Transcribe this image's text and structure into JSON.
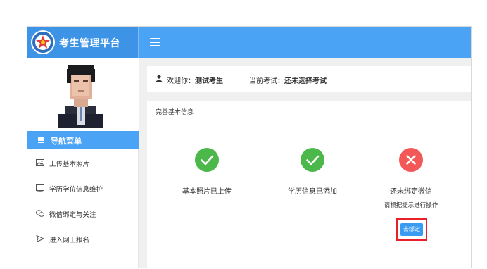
{
  "app": {
    "title": "考生管理平台"
  },
  "sidebar": {
    "nav_header": "导航菜单",
    "items": [
      {
        "label": "上传基本照片",
        "icon": "image-icon"
      },
      {
        "label": "学历学位信息维护",
        "icon": "card-icon"
      },
      {
        "label": "微信绑定与关注",
        "icon": "wechat-icon"
      },
      {
        "label": "进入网上报名",
        "icon": "send-icon"
      }
    ]
  },
  "header": {
    "welcome_prefix": "欢迎你：",
    "user_name": "测试考生",
    "exam_prefix": "当前考试：",
    "exam_value": "还未选择考试"
  },
  "panel": {
    "title": "完善基本信息",
    "steps": [
      {
        "label": "基本照片已上传",
        "status": "done"
      },
      {
        "label": "学历信息已添加",
        "status": "done"
      },
      {
        "label": "还未绑定微信",
        "status": "pending",
        "hint": "请根据提示进行操作",
        "button": "去绑定"
      }
    ]
  },
  "colors": {
    "accent": "#4aa3f5",
    "success": "#4cb84c",
    "error": "#f25858",
    "highlight_border": "#e8202a"
  }
}
